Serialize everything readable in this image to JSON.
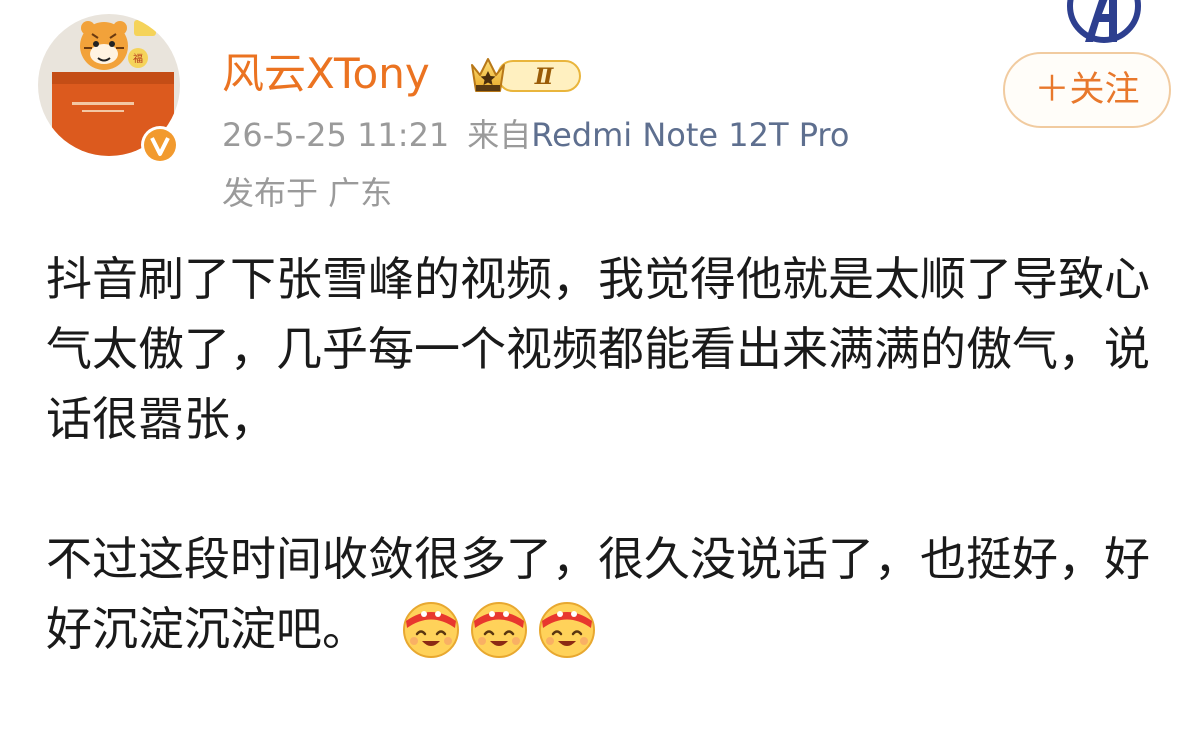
{
  "user": {
    "name": "风云XTony",
    "vip_level": "Ⅱ",
    "verified": true,
    "accent_color": "#eb7321"
  },
  "meta": {
    "timestamp": "26-5-25 11:21",
    "source_prefix": "来自",
    "device": "Redmi Note 12T Pro",
    "location": "发布于 广东"
  },
  "follow_button": {
    "label": "＋关注"
  },
  "post": {
    "paragraph_1": "抖音刷了下张雪峰的视频，我觉得他就是太顺了导致心气太傲了，几乎每一个视频都能看出来满满的傲气，说话很嚣张，",
    "paragraph_2": "不过这段时间收敛很多了，很久没说话了，也挺好，好好沉淀沉淀吧。",
    "emojis": [
      "grinning-headband-emoji",
      "grinning-headband-emoji",
      "grinning-headband-emoji"
    ]
  }
}
